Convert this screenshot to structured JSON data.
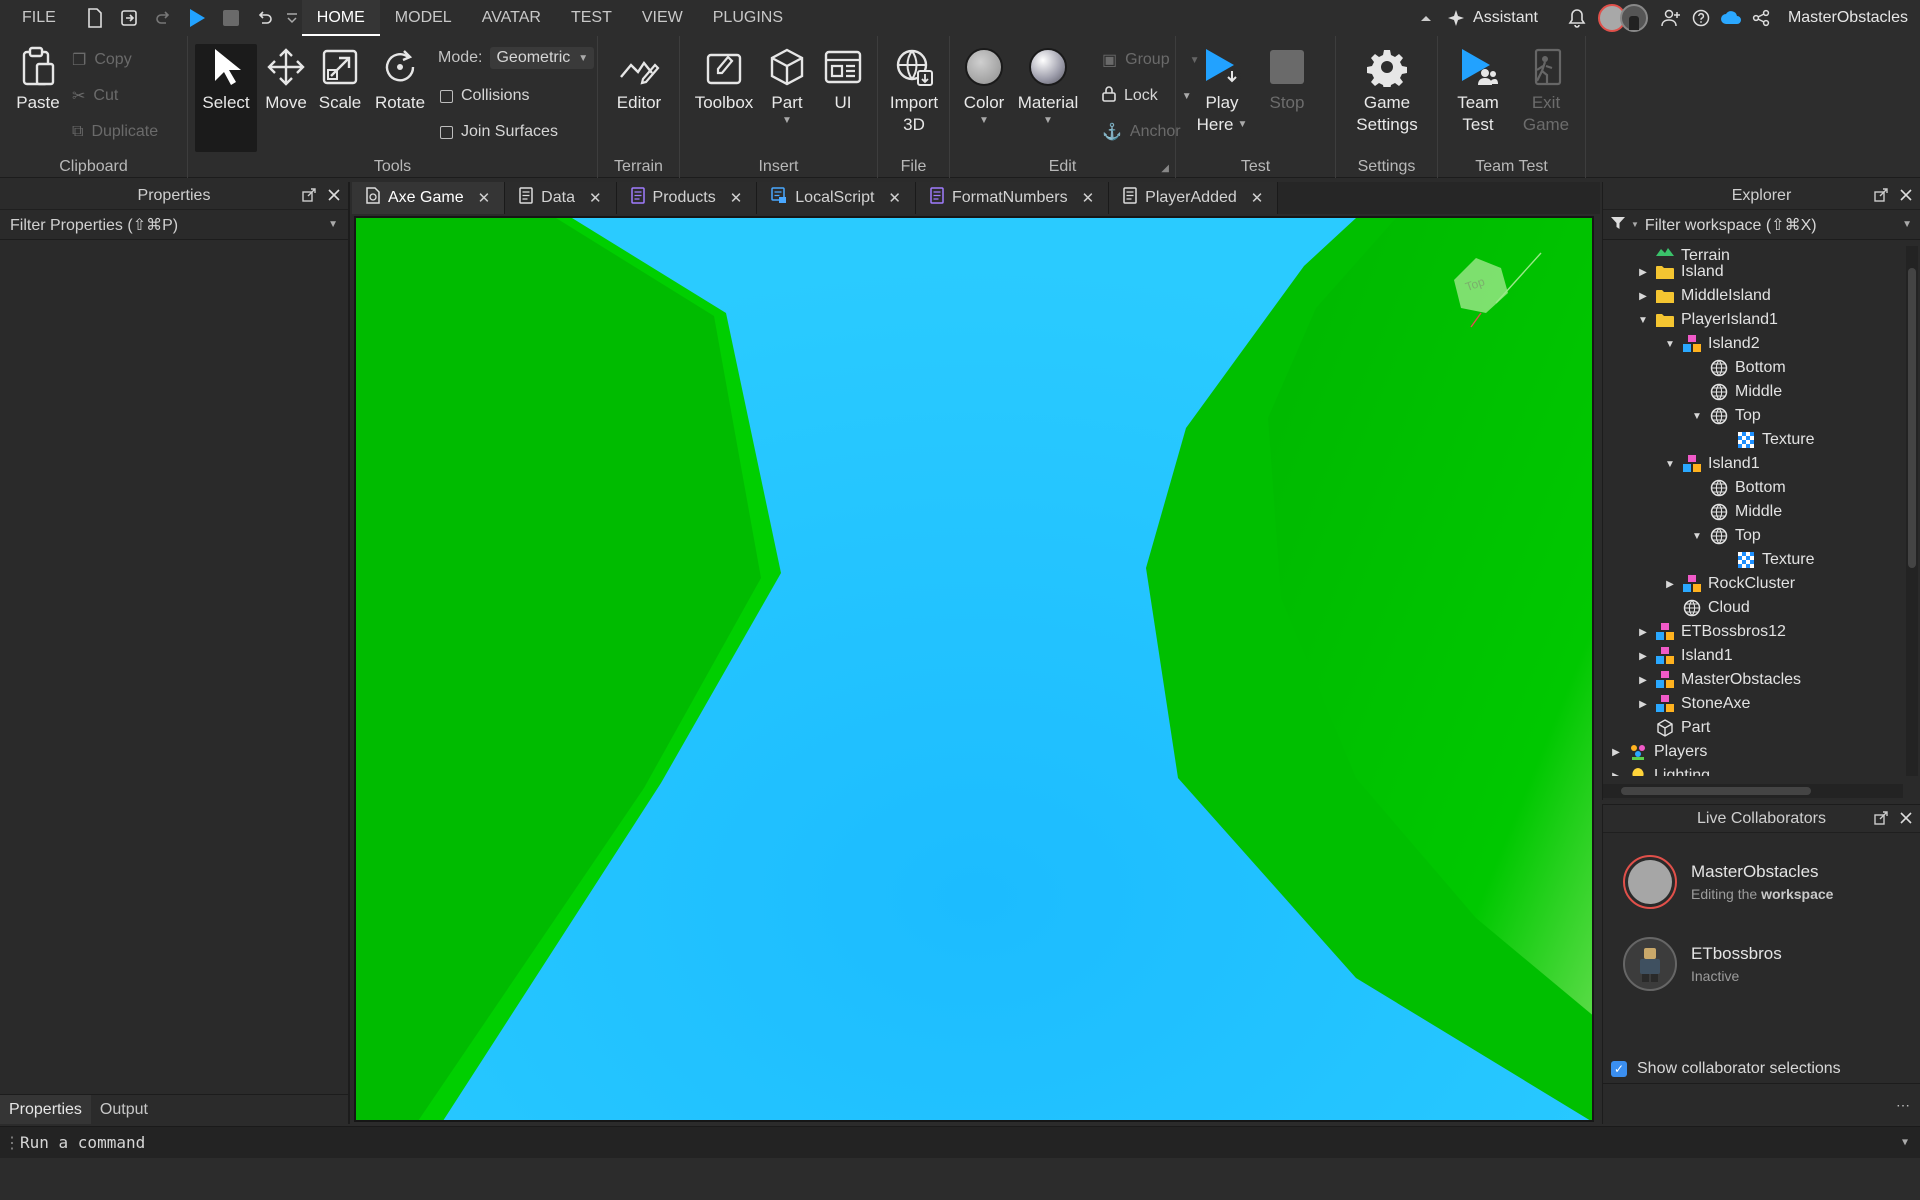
{
  "menubar": {
    "file": "FILE",
    "tabs": [
      "HOME",
      "MODEL",
      "AVATAR",
      "TEST",
      "VIEW",
      "PLUGINS"
    ],
    "active_tab": "HOME",
    "assistant": "Assistant",
    "username": "MasterObstacles"
  },
  "ribbon": {
    "clipboard": {
      "group": "Clipboard",
      "paste": "Paste",
      "copy": "Copy",
      "cut": "Cut",
      "duplicate": "Duplicate"
    },
    "tools": {
      "group": "Tools",
      "select": "Select",
      "move": "Move",
      "scale": "Scale",
      "rotate": "Rotate",
      "mode_label": "Mode:",
      "mode_value": "Geometric",
      "collisions": "Collisions",
      "join_surfaces": "Join Surfaces"
    },
    "terrain": {
      "group": "Terrain",
      "editor": "Editor"
    },
    "insert": {
      "group": "Insert",
      "toolbox": "Toolbox",
      "part": "Part",
      "ui": "UI"
    },
    "file": {
      "group": "File",
      "import_line1": "Import",
      "import_line2": "3D"
    },
    "edit": {
      "group": "Edit",
      "color": "Color",
      "material": "Material",
      "group_btn": "Group",
      "lock": "Lock",
      "anchor": "Anchor"
    },
    "test": {
      "group": "Test",
      "play_line1": "Play",
      "play_line2": "Here",
      "stop": "Stop"
    },
    "settings": {
      "group": "Settings",
      "game_line1": "Game",
      "game_line2": "Settings"
    },
    "team_test": {
      "group": "Team Test",
      "team_line1": "Team",
      "team_line2": "Test",
      "exit_line1": "Exit",
      "exit_line2": "Game"
    }
  },
  "properties": {
    "title": "Properties",
    "filter": "Filter Properties (⇧⌘P)",
    "bottom_tabs": [
      "Properties",
      "Output"
    ]
  },
  "doc_tabs": [
    {
      "label": "Axe Game",
      "icon": "place-icon",
      "active": true
    },
    {
      "label": "Data",
      "icon": "script-icon",
      "active": false
    },
    {
      "label": "Products",
      "icon": "module-script-icon",
      "active": false
    },
    {
      "label": "LocalScript",
      "icon": "local-script-icon",
      "active": false
    },
    {
      "label": "FormatNumbers",
      "icon": "module-script-icon",
      "active": false
    },
    {
      "label": "PlayerAdded",
      "icon": "script-icon",
      "active": false
    }
  ],
  "viewport": {
    "view_cube_label": "Top",
    "colors": {
      "water": "#22c3ff",
      "grass": "#00d600",
      "grass_dark": "#00b800"
    }
  },
  "explorer": {
    "title": "Explorer",
    "filter": "Filter workspace (⇧⌘X)",
    "items": [
      {
        "label": "Terrain",
        "depth": 2,
        "arrow": "",
        "icon": "terrain"
      },
      {
        "label": "Island",
        "depth": 2,
        "arrow": "right",
        "icon": "folder"
      },
      {
        "label": "MiddleIsland",
        "depth": 2,
        "arrow": "right",
        "icon": "folder"
      },
      {
        "label": "PlayerIsland1",
        "depth": 2,
        "arrow": "down",
        "icon": "folder"
      },
      {
        "label": "Island2",
        "depth": 3,
        "arrow": "down",
        "icon": "model"
      },
      {
        "label": "Bottom",
        "depth": 4,
        "arrow": "",
        "icon": "mesh"
      },
      {
        "label": "Middle",
        "depth": 4,
        "arrow": "",
        "icon": "mesh"
      },
      {
        "label": "Top",
        "depth": 4,
        "arrow": "down",
        "icon": "mesh"
      },
      {
        "label": "Texture",
        "depth": 5,
        "arrow": "",
        "icon": "texture"
      },
      {
        "label": "Island1",
        "depth": 3,
        "arrow": "down",
        "icon": "model"
      },
      {
        "label": "Bottom",
        "depth": 4,
        "arrow": "",
        "icon": "mesh"
      },
      {
        "label": "Middle",
        "depth": 4,
        "arrow": "",
        "icon": "mesh"
      },
      {
        "label": "Top",
        "depth": 4,
        "arrow": "down",
        "icon": "mesh"
      },
      {
        "label": "Texture",
        "depth": 5,
        "arrow": "",
        "icon": "texture"
      },
      {
        "label": "RockCluster",
        "depth": 3,
        "arrow": "right",
        "icon": "model"
      },
      {
        "label": "Cloud",
        "depth": 3,
        "arrow": "",
        "icon": "mesh"
      },
      {
        "label": "ETBossbros12",
        "depth": 2,
        "arrow": "right",
        "icon": "model"
      },
      {
        "label": "Island1",
        "depth": 2,
        "arrow": "right",
        "icon": "model"
      },
      {
        "label": "MasterObstacles",
        "depth": 2,
        "arrow": "right",
        "icon": "model"
      },
      {
        "label": "StoneAxe",
        "depth": 2,
        "arrow": "right",
        "icon": "model"
      },
      {
        "label": "Part",
        "depth": 2,
        "arrow": "",
        "icon": "part"
      },
      {
        "label": "Players",
        "depth": 1,
        "arrow": "right",
        "icon": "players"
      },
      {
        "label": "Lighting",
        "depth": 1,
        "arrow": "right",
        "icon": "lighting"
      }
    ]
  },
  "collaborators": {
    "title": "Live Collaborators",
    "users": [
      {
        "name": "MasterObstacles",
        "status_prefix": "Editing the ",
        "status_bold": "workspace",
        "ring": "#e0504a"
      },
      {
        "name": "ETbossbros",
        "status_prefix": "Inactive",
        "status_bold": "",
        "ring": "#666666"
      }
    ],
    "show_selections": "Show collaborator selections"
  },
  "command_bar": {
    "placeholder": "Run a command"
  }
}
